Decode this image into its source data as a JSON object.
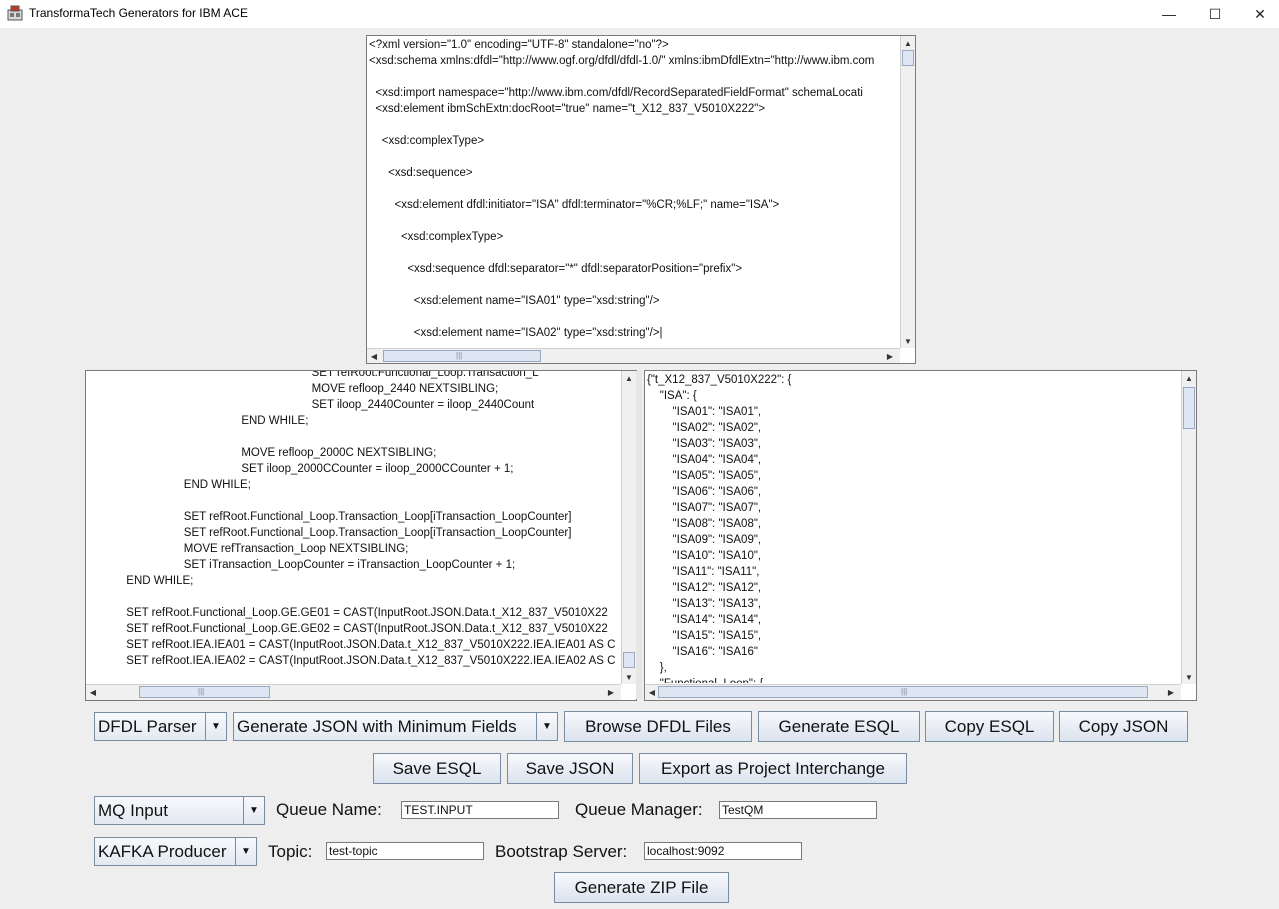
{
  "window": {
    "title": "TransformaTech Generators for IBM ACE",
    "minimize_glyph": "—",
    "maximize_glyph": "☐",
    "close_glyph": "✕",
    "app_icon": "app-logo-icon"
  },
  "xsd_editor": {
    "lines": [
      "<?xml version=\"1.0\" encoding=\"UTF-8\" standalone=\"no\"?>",
      "<xsd:schema xmlns:dfdl=\"http://www.ogf.org/dfdl/dfdl-1.0/\" xmlns:ibmDfdlExtn=\"http://www.ibm.com",
      "",
      "  <xsd:import namespace=\"http://www.ibm.com/dfdl/RecordSeparatedFieldFormat\" schemaLocati",
      "  <xsd:element ibmSchExtn:docRoot=\"true\" name=\"t_X12_837_V5010X222\">",
      "",
      "    <xsd:complexType>",
      "",
      "      <xsd:sequence>",
      "",
      "        <xsd:element dfdl:initiator=\"ISA\" dfdl:terminator=\"%CR;%LF;\" name=\"ISA\">",
      "",
      "          <xsd:complexType>",
      "",
      "            <xsd:sequence dfdl:separator=\"*\" dfdl:separatorPosition=\"prefix\">",
      "",
      "              <xsd:element name=\"ISA01\" type=\"xsd:string\"/>",
      "",
      "              <xsd:element name=\"ISA02\" type=\"xsd:string\"/>|"
    ]
  },
  "esql_editor": {
    "lines": [
      "                                                                                SET refRoot.Functional_Loop.Transaction_L",
      "                                                                                MOVE refloop_2440 NEXTSIBLING;",
      "                                                                                SET iloop_2440Counter = iloop_2440Count",
      "                                                          END WHILE;",
      "",
      "                                                          MOVE refloop_2000C NEXTSIBLING;",
      "                                                          SET iloop_2000CCounter = iloop_2000CCounter + 1;",
      "                                        END WHILE;",
      "",
      "                                        SET refRoot.Functional_Loop.Transaction_Loop[iTransaction_LoopCounter]",
      "                                        SET refRoot.Functional_Loop.Transaction_Loop[iTransaction_LoopCounter]",
      "                                        MOVE refTransaction_Loop NEXTSIBLING;",
      "                                        SET iTransaction_LoopCounter = iTransaction_LoopCounter + 1;",
      "                      END WHILE;",
      "",
      "                      SET refRoot.Functional_Loop.GE.GE01 = CAST(InputRoot.JSON.Data.t_X12_837_V5010X22",
      "                      SET refRoot.Functional_Loop.GE.GE02 = CAST(InputRoot.JSON.Data.t_X12_837_V5010X22",
      "                      SET refRoot.IEA.IEA01 = CAST(InputRoot.JSON.Data.t_X12_837_V5010X222.IEA.IEA01 AS C",
      "                      SET refRoot.IEA.IEA02 = CAST(InputRoot.JSON.Data.t_X12_837_V5010X222.IEA.IEA02 AS C"
    ]
  },
  "json_editor": {
    "lines": [
      "{\"t_X12_837_V5010X222\": {",
      "    \"ISA\": {",
      "        \"ISA01\": \"ISA01\",",
      "        \"ISA02\": \"ISA02\",",
      "        \"ISA03\": \"ISA03\",",
      "        \"ISA04\": \"ISA04\",",
      "        \"ISA05\": \"ISA05\",",
      "        \"ISA06\": \"ISA06\",",
      "        \"ISA07\": \"ISA07\",",
      "        \"ISA08\": \"ISA08\",",
      "        \"ISA09\": \"ISA09\",",
      "        \"ISA10\": \"ISA10\",",
      "        \"ISA11\": \"ISA11\",",
      "        \"ISA12\": \"ISA12\",",
      "        \"ISA13\": \"ISA13\",",
      "        \"ISA14\": \"ISA14\",",
      "        \"ISA15\": \"ISA15\",",
      "        \"ISA16\": \"ISA16\"",
      "    },",
      "    \"Functional_Loop\": {"
    ]
  },
  "toolbar_row1": {
    "parser_select": "DFDL Parser",
    "mode_select": "Generate JSON with Minimum Fields",
    "browse_label": "Browse DFDL Files",
    "generate_esql_label": "Generate ESQL",
    "copy_esql_label": "Copy ESQL",
    "copy_json_label": "Copy JSON"
  },
  "toolbar_row2": {
    "save_esql_label": "Save ESQL",
    "save_json_label": "Save JSON",
    "export_label": "Export as Project Interchange"
  },
  "input_config": {
    "type_select": "MQ Input",
    "queue_name_label": "Queue Name:",
    "queue_name_value": "TEST.INPUT",
    "queue_manager_label": "Queue Manager:",
    "queue_manager_value": "TestQM"
  },
  "output_config": {
    "type_select": "KAFKA Producer",
    "topic_label": "Topic:",
    "topic_value": "test-topic",
    "bootstrap_label": "Bootstrap Server:",
    "bootstrap_value": "localhost:9092"
  },
  "generate_zip_label": "Generate ZIP File",
  "icons": {
    "up": "▲",
    "down": "▼",
    "left": "◀",
    "right": "▶",
    "dropdown": "▼",
    "grip_v": "≡",
    "grip_h": "|||"
  }
}
